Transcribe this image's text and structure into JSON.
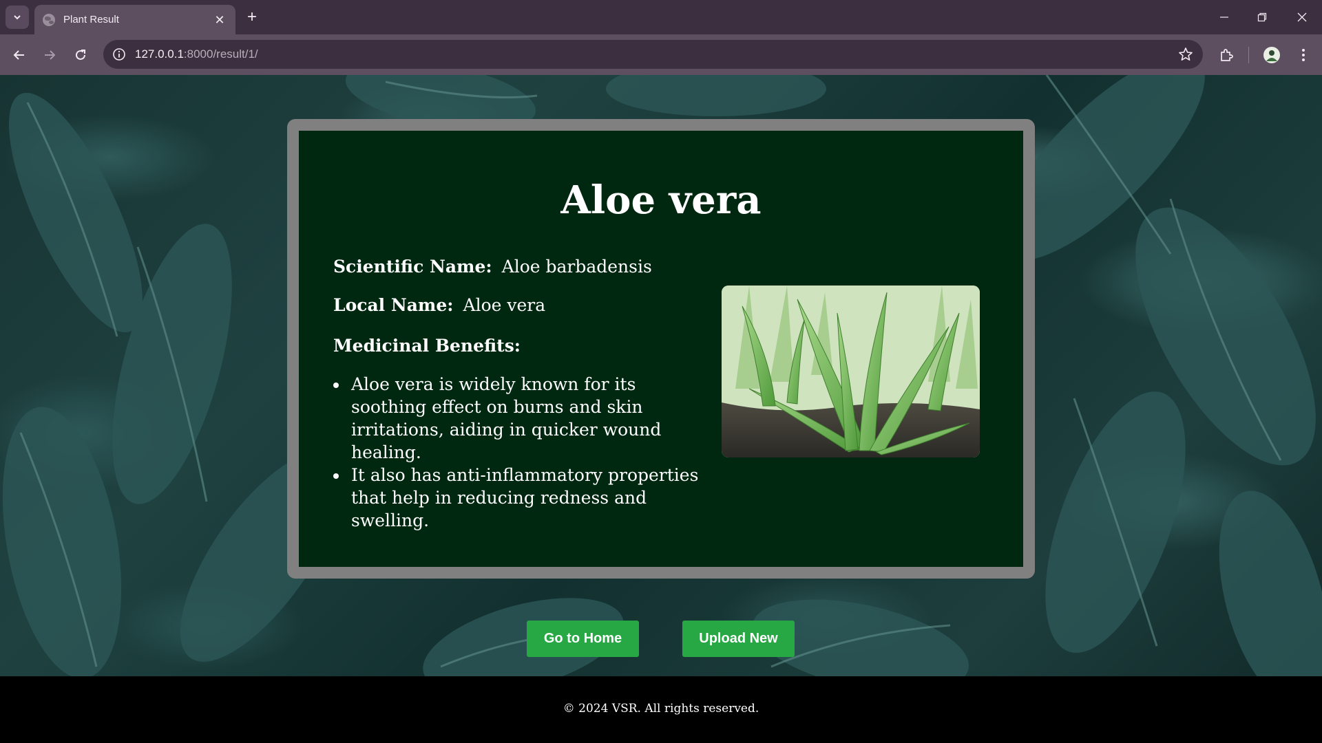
{
  "browser": {
    "tab_title": "Plant Result",
    "url_host": "127.0.0.1",
    "url_path": ":8000/result/1/",
    "icons": [
      "tab-search-icon",
      "globe-icon",
      "close-icon",
      "plus-icon",
      "minimize-icon",
      "restore-icon",
      "window-close-icon",
      "back-arrow-icon",
      "forward-arrow-icon",
      "reload-icon",
      "site-info-icon",
      "star-icon",
      "extensions-icon",
      "profile-avatar",
      "more-vert-icon"
    ]
  },
  "plant": {
    "name": "Aloe vera",
    "scientific_label": "Scientific Name:",
    "scientific_name": "Aloe barbadensis",
    "local_label": "Local Name:",
    "local_name": "Aloe vera",
    "benefits_heading": "Medicinal Benefits:",
    "benefits": [
      "Aloe vera is widely known for its soothing effect on burns and skin irritations, aiding in quicker wound healing.",
      "It also has anti-inflammatory properties that help in reducing redness and swelling."
    ]
  },
  "actions": {
    "home_label": "Go to Home",
    "upload_label": "Upload New"
  },
  "footer": {
    "text": "© 2024 VSR. All rights reserved."
  },
  "colors": {
    "card_bg": "#002811",
    "frame": "#808080",
    "button": "#28a745",
    "chrome_dark": "#3c2f3f",
    "chrome_light": "#5e4f60"
  }
}
